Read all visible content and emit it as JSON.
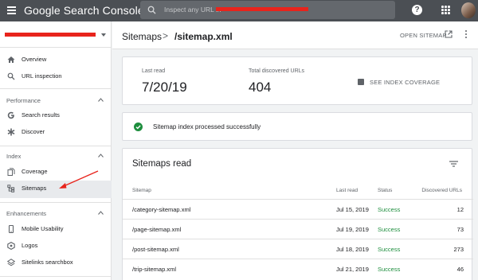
{
  "app": {
    "name": "Google Search Console",
    "search_placeholder": "Inspect any URL in"
  },
  "icons": {
    "menu": "hamburger-icon",
    "search": "search-icon",
    "help": "help-icon",
    "apps": "apps-grid-icon",
    "open": "open-in-new-icon",
    "more": "more-vert-icon",
    "coverage": "bar-chart-icon",
    "success": "check-circle-icon",
    "filter": "filter-icon"
  },
  "colors": {
    "topbar": "#4b4f54",
    "success": "#1e8e3e",
    "redaction": "#e8241c",
    "annotation_arrow": "#e8241c"
  },
  "sidebar": {
    "property_caret_icon": "arrow-drop-down-icon",
    "items": [
      {
        "label": "Overview",
        "icon": "home-icon"
      },
      {
        "label": "URL inspection",
        "icon": "search-icon"
      }
    ],
    "sections": [
      {
        "title": "Performance",
        "items": [
          {
            "label": "Search results",
            "icon": "google-g-icon"
          },
          {
            "label": "Discover",
            "icon": "asterisk-icon"
          }
        ]
      },
      {
        "title": "Index",
        "items": [
          {
            "label": "Coverage",
            "icon": "file-copy-icon"
          },
          {
            "label": "Sitemaps",
            "icon": "sitemap-icon",
            "active": true
          }
        ]
      },
      {
        "title": "Enhancements",
        "items": [
          {
            "label": "Mobile Usability",
            "icon": "smartphone-icon"
          },
          {
            "label": "Logos",
            "icon": "logo-icon"
          },
          {
            "label": "Sitelinks searchbox",
            "icon": "layers-icon"
          }
        ]
      }
    ]
  },
  "header": {
    "breadcrumb_root": "Sitemaps",
    "breadcrumb_sep": ">",
    "breadcrumb_current": "/sitemap.xml",
    "open_sitemap_label": "OPEN SITEMAP"
  },
  "stats": {
    "last_read_label": "Last read",
    "last_read_value": "7/20/19",
    "total_urls_label": "Total discovered URLs",
    "total_urls_value": "404",
    "coverage_link": "SEE INDEX COVERAGE"
  },
  "status_message": "Sitemap index processed successfully",
  "table": {
    "title": "Sitemaps read",
    "columns": [
      "Sitemap",
      "Last read",
      "Status",
      "Discovered URLs"
    ],
    "rows": [
      {
        "sitemap": "/category-sitemap.xml",
        "last_read": "Jul 15, 2019",
        "status": "Success",
        "discovered": "12"
      },
      {
        "sitemap": "/page-sitemap.xml",
        "last_read": "Jul 19, 2019",
        "status": "Success",
        "discovered": "73"
      },
      {
        "sitemap": "/post-sitemap.xml",
        "last_read": "Jul 18, 2019",
        "status": "Success",
        "discovered": "273"
      },
      {
        "sitemap": "/trip-sitemap.xml",
        "last_read": "Jul 21, 2019",
        "status": "Success",
        "discovered": "46"
      }
    ]
  }
}
